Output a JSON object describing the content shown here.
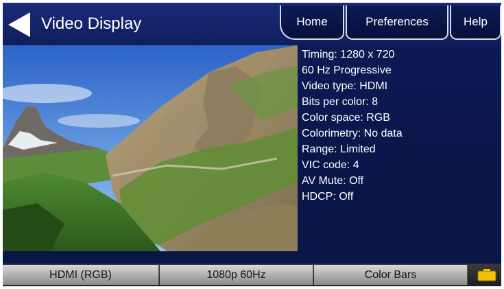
{
  "header": {
    "title": "Video Display",
    "tabs": {
      "home": "Home",
      "preferences": "Preferences",
      "help": "Help"
    }
  },
  "info": {
    "timing": "Timing: 1280 x 720",
    "scan": "60 Hz Progressive",
    "video_type": "Video type: HDMI",
    "bits_per_color": "Bits per color: 8",
    "color_space": "Color space: RGB",
    "colorimetry": "Colorimetry: No data",
    "range": "Range: Limited",
    "vic_code": "VIC code: 4",
    "av_mute": "AV Mute: Off",
    "hdcp": "HDCP: Off"
  },
  "footer": {
    "interface": "HDMI (RGB)",
    "format": "1080p 60Hz",
    "image": "Color Bars"
  },
  "icons": {
    "back": "back-arrow-icon",
    "battery": "battery-icon"
  },
  "colors": {
    "header_bg": "#1a2c78",
    "panel_bg": "#0a1645",
    "battery_fill": "#f2c200"
  }
}
